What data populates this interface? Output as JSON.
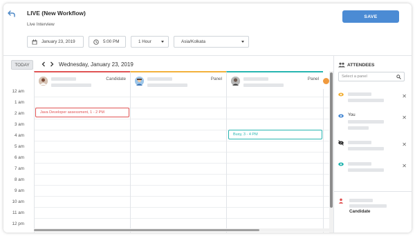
{
  "header": {
    "title": "LIVE (New Workflow)",
    "subtitle": "Live Interview",
    "save_label": "SAVE",
    "date": "January 23, 2019",
    "time": "5:00 PM",
    "duration": "1 Hour",
    "timezone": "Asia/Kolkata"
  },
  "toolbar": {
    "today_label": "TODAY",
    "date_label": "Wednesday, January 23, 2019"
  },
  "columns": [
    {
      "role": "Candidate",
      "accent": "#e05252"
    },
    {
      "role": "Panel",
      "accent": "#f2b13a"
    },
    {
      "role": "Panel",
      "accent": "#26b5b0"
    }
  ],
  "hours": [
    "12 am",
    "1 am",
    "2 am",
    "3 am",
    "4 am",
    "5 am",
    "6 am",
    "7 am",
    "8 am",
    "9 am",
    "10 am",
    "11 am",
    "12 pm"
  ],
  "events": [
    {
      "label": "Java Developer assessment, 1 - 2 PM",
      "color": "#e05252"
    },
    {
      "label": "Busy, 3 - 4 PM",
      "color": "#26b5b0"
    }
  ],
  "sidebar": {
    "title": "ATTENDEES",
    "search_placeholder": "Select a panel",
    "attendees": [
      {
        "name": "",
        "icon": "eye-icon",
        "color": "#f2b13a"
      },
      {
        "name": "You",
        "icon": "eye-icon",
        "color": "#4b8bd4"
      },
      {
        "name": "",
        "icon": "eye-off-icon",
        "color": "#333333"
      },
      {
        "name": "",
        "icon": "eye-icon",
        "color": "#26b5b0"
      }
    ],
    "candidate_label": "Candidate"
  }
}
